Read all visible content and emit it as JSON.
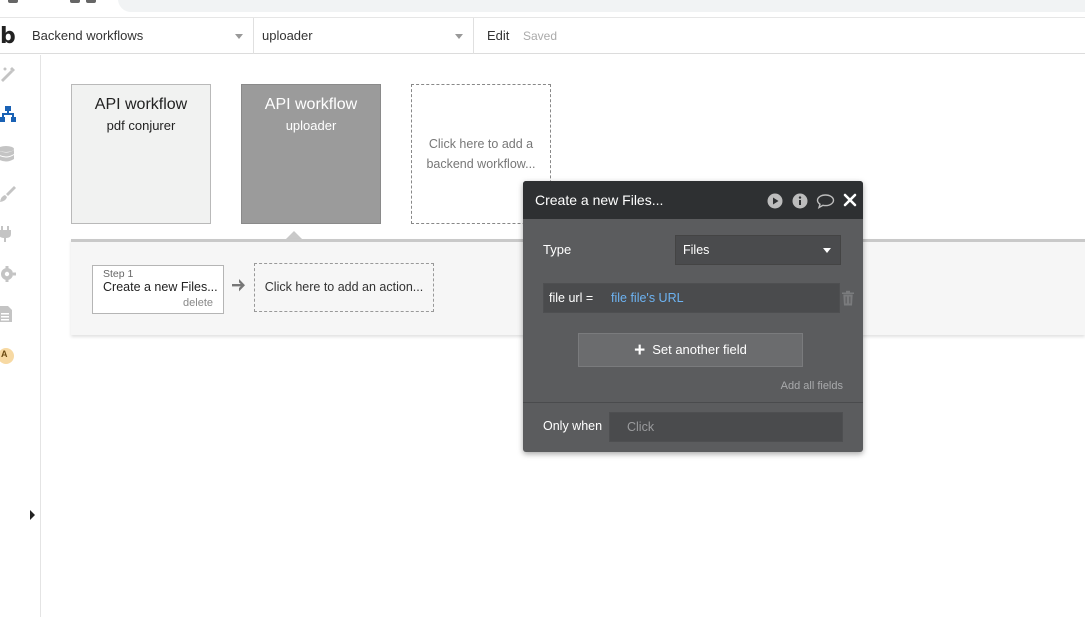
{
  "topbar": {
    "page_dropdown": "Backend workflows",
    "workflow_dropdown": "uploader",
    "edit_label": "Edit",
    "saved_label": "Saved"
  },
  "sidebar": {
    "logo": "b",
    "icons": [
      "design-icon",
      "workflow-icon",
      "data-icon",
      "styles-icon",
      "plugins-icon",
      "settings-icon",
      "logs-icon",
      "user-avatar"
    ],
    "avatar_letter": "A"
  },
  "workflows": [
    {
      "title": "API workflow",
      "name": "pdf conjurer",
      "selected": false
    },
    {
      "title": "API workflow",
      "name": "uploader",
      "selected": true
    }
  ],
  "add_workflow_label": "Click here to add a backend workflow...",
  "steps": [
    {
      "number": "Step 1",
      "name": "Create a new Files...",
      "delete_label": "delete"
    }
  ],
  "add_action_label": "Click here to add an action...",
  "dialog": {
    "title": "Create a new Files...",
    "type_label": "Type",
    "type_value": "Files",
    "field_key": "file url =",
    "field_value": "file  file's URL",
    "set_field_label": "Set another field",
    "add_all_label": "Add all fields",
    "only_when_label": "Only when",
    "condition_placeholder": "Click"
  },
  "colors": {
    "accent": "#1a73c9",
    "dialog_bg": "#5b5c5e",
    "dialog_header": "#2e3032",
    "expression_blue": "#6db3f2",
    "selected_card": "#9b9b9b"
  }
}
